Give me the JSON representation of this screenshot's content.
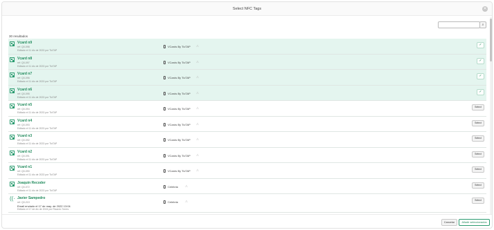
{
  "modal": {
    "title": "Select NFC Tags",
    "close_glyph": "✕"
  },
  "search": {
    "value": "",
    "placeholder": "",
    "button_glyph": "⌕"
  },
  "results_count": "30 resultados",
  "items": [
    {
      "name": "Vcard n9",
      "ref": "ref: Q0-098",
      "date": "Editado el 11 dic de 2023 por TicTAP",
      "product": "VCards By TicTAP",
      "selected": true,
      "icon": "qr-icon"
    },
    {
      "name": "Vcard n8",
      "ref": "ref: Q0-097",
      "date": "Editado el 11 dic de 2023 por TicTAP",
      "product": "VCards By TicTAP",
      "selected": true,
      "icon": "qr-icon"
    },
    {
      "name": "Vcard n7",
      "ref": "ref: Q0-096",
      "date": "Editado el 11 dic de 2023 por TicTAP",
      "product": "VCards By TicTAP",
      "selected": true,
      "icon": "qr-icon"
    },
    {
      "name": "Vcard n6",
      "ref": "ref: Q0-095",
      "date": "Editado el 11 dic de 2023 por TicTAP",
      "product": "VCards By TicTAP",
      "selected": true,
      "icon": "qr-icon"
    },
    {
      "name": "Vcard n5",
      "ref": "ref: Q0-094",
      "date": "Editado el 11 dic de 2023 por TicTAP",
      "product": "VCards By TicTAP",
      "selected": false,
      "icon": "qr-icon"
    },
    {
      "name": "Vcard n4",
      "ref": "ref: Q0-093",
      "date": "Editado el 11 dic de 2023 por TicTAP",
      "product": "VCards By TicTAP",
      "selected": false,
      "icon": "qr-icon"
    },
    {
      "name": "Vcard n3",
      "ref": "ref: Q0-092",
      "date": "Editado el 11 dic de 2023 por TicTAP",
      "product": "VCards By TicTAP",
      "selected": false,
      "icon": "qr-icon"
    },
    {
      "name": "Vcard n2",
      "ref": "ref: Q0-091",
      "date": "Editado el 11 dic de 2023 por TicTAP",
      "product": "VCards By TicTAP",
      "selected": false,
      "icon": "qr-icon"
    },
    {
      "name": "Vcard n1",
      "ref": "ref: Q0-090",
      "date": "Editado el 11 dic de 2023 por TicTAP",
      "product": "VCards By TicTAP",
      "selected": false,
      "icon": "qr-icon"
    },
    {
      "name": "Joaquin Recoder",
      "ref": "ref: Q0-072",
      "date": "Editado el 11 dic de 2023 por TicTAP",
      "product": "Celebria",
      "selected": false,
      "icon": "qr-icon"
    },
    {
      "name": "Javier Sampedro",
      "ref": "ref: Q0-219",
      "email": "Email enviado el 17 de may. de 2022 13:04",
      "date": "Editado el 17 de dic de 2024 por Ricardo Torres",
      "product": "Celebria",
      "selected": false,
      "icon": "nfc-icon"
    }
  ],
  "labels": {
    "select": "Select",
    "check_glyph": "✓",
    "warn_glyph": "⚠"
  },
  "footer": {
    "cancel": "Cancelar",
    "add": "Añadir seleccionados"
  },
  "colors": {
    "accent": "#1f8a5b",
    "selected_row": "#e4f5ef"
  }
}
